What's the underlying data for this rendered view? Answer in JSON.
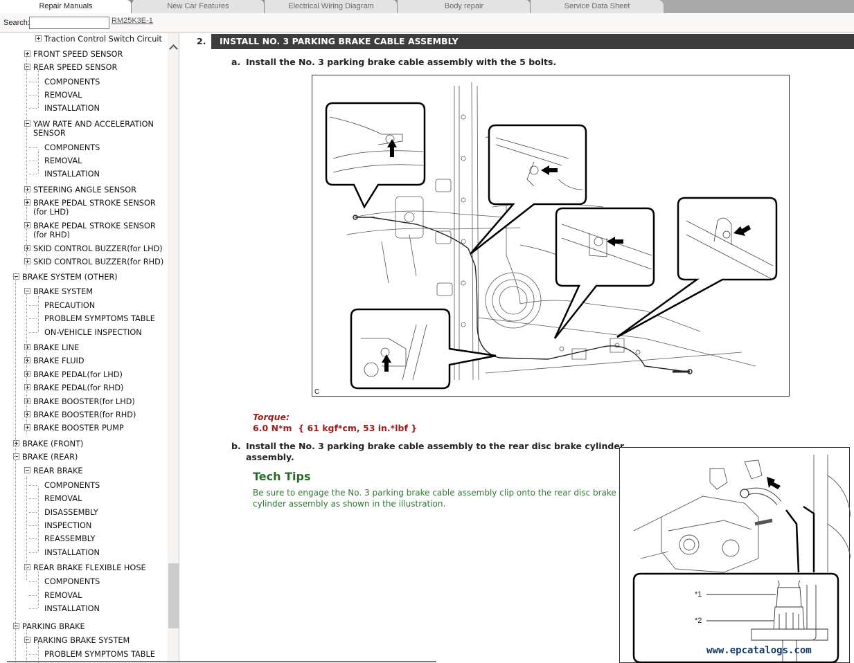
{
  "tabs": [
    {
      "label": "Repair Manuals",
      "active": true
    },
    {
      "label": "New Car Features",
      "active": false
    },
    {
      "label": "Electrical Wiring Diagram",
      "active": false
    },
    {
      "label": "Body repair",
      "active": false
    },
    {
      "label": "Service Data Sheet",
      "active": false
    }
  ],
  "search": {
    "label": "Search:",
    "value": "",
    "placeholder": ""
  },
  "doc_id": "RM25K3E-1",
  "tree": [
    {
      "label": "Traction Control Switch Circuit",
      "level": 3,
      "toggle": "plus"
    },
    {
      "label": "FRONT SPEED SENSOR",
      "level": 2,
      "toggle": "plus"
    },
    {
      "label": "REAR SPEED SENSOR",
      "level": 2,
      "toggle": "minus"
    },
    {
      "label": "COMPONENTS",
      "level": 3,
      "toggle": "none"
    },
    {
      "label": "REMOVAL",
      "level": 3,
      "toggle": "none"
    },
    {
      "label": "INSTALLATION",
      "level": 3,
      "toggle": "none"
    },
    {
      "label": "YAW RATE AND ACCELERATION",
      "label2": "SENSOR",
      "level": 2,
      "toggle": "minus"
    },
    {
      "label": "COMPONENTS",
      "level": 3,
      "toggle": "none"
    },
    {
      "label": "REMOVAL",
      "level": 3,
      "toggle": "none"
    },
    {
      "label": "INSTALLATION",
      "level": 3,
      "toggle": "none"
    },
    {
      "label": "STEERING ANGLE SENSOR",
      "level": 2,
      "toggle": "plus"
    },
    {
      "label": "BRAKE PEDAL STROKE SENSOR",
      "label2": "(for LHD)",
      "level": 2,
      "toggle": "plus"
    },
    {
      "label": "BRAKE PEDAL STROKE SENSOR",
      "label2": "(for RHD)",
      "level": 2,
      "toggle": "plus"
    },
    {
      "label": "SKID CONTROL BUZZER(for LHD)",
      "level": 2,
      "toggle": "plus"
    },
    {
      "label": "SKID CONTROL BUZZER(for RHD)",
      "level": 2,
      "toggle": "plus"
    },
    {
      "label": "BRAKE SYSTEM (OTHER)",
      "level": 1,
      "toggle": "minus"
    },
    {
      "label": "BRAKE SYSTEM",
      "level": 2,
      "toggle": "minus"
    },
    {
      "label": "PRECAUTION",
      "level": 3,
      "toggle": "none"
    },
    {
      "label": "PROBLEM SYMPTOMS TABLE",
      "level": 3,
      "toggle": "none"
    },
    {
      "label": "ON-VEHICLE INSPECTION",
      "level": 3,
      "toggle": "none"
    },
    {
      "label": "BRAKE LINE",
      "level": 2,
      "toggle": "plus"
    },
    {
      "label": "BRAKE FLUID",
      "level": 2,
      "toggle": "plus"
    },
    {
      "label": "BRAKE PEDAL(for LHD)",
      "level": 2,
      "toggle": "plus"
    },
    {
      "label": "BRAKE PEDAL(for RHD)",
      "level": 2,
      "toggle": "plus"
    },
    {
      "label": "BRAKE BOOSTER(for LHD)",
      "level": 2,
      "toggle": "plus"
    },
    {
      "label": "BRAKE BOOSTER(for RHD)",
      "level": 2,
      "toggle": "plus"
    },
    {
      "label": "BRAKE BOOSTER PUMP",
      "level": 2,
      "toggle": "plus"
    },
    {
      "label": "BRAKE (FRONT)",
      "level": 1,
      "toggle": "plus"
    },
    {
      "label": "BRAKE (REAR)",
      "level": 1,
      "toggle": "minus"
    },
    {
      "label": "REAR BRAKE",
      "level": 2,
      "toggle": "minus"
    },
    {
      "label": "COMPONENTS",
      "level": 3,
      "toggle": "none"
    },
    {
      "label": "REMOVAL",
      "level": 3,
      "toggle": "none"
    },
    {
      "label": "DISASSEMBLY",
      "level": 3,
      "toggle": "none"
    },
    {
      "label": "INSPECTION",
      "level": 3,
      "toggle": "none"
    },
    {
      "label": "REASSEMBLY",
      "level": 3,
      "toggle": "none"
    },
    {
      "label": "INSTALLATION",
      "level": 3,
      "toggle": "none"
    },
    {
      "label": "REAR BRAKE FLEXIBLE HOSE",
      "level": 2,
      "toggle": "minus"
    },
    {
      "label": "COMPONENTS",
      "level": 3,
      "toggle": "none"
    },
    {
      "label": "REMOVAL",
      "level": 3,
      "toggle": "none"
    },
    {
      "label": "INSTALLATION",
      "level": 3,
      "toggle": "none"
    },
    {
      "label": "PARKING BRAKE",
      "level": 1,
      "toggle": "minus"
    },
    {
      "label": "PARKING BRAKE SYSTEM",
      "level": 2,
      "toggle": "minus"
    },
    {
      "label": "PROBLEM SYMPTOMS TABLE",
      "level": 3,
      "toggle": "none"
    }
  ],
  "content": {
    "step_number": "2.",
    "step_title": "INSTALL NO. 3 PARKING BRAKE CABLE ASSEMBLY",
    "substep_a": {
      "letter": "a.",
      "text": "Install the No. 3 parking brake cable assembly with the 5 bolts."
    },
    "figure1_label": "C",
    "torque": {
      "label": "Torque:",
      "value": "6.0 N*m  { 61 kgf*cm, 53 in.*lbf }"
    },
    "substep_b": {
      "letter": "b.",
      "text_line1": "Install the No. 3 parking brake cable assembly to the rear disc brake cylinder",
      "text_line2": "assembly."
    },
    "tech_tips": {
      "title": "Tech Tips",
      "text": "Be sure to engage the No. 3 parking brake cable assembly clip onto the rear disc brake cylinder assembly as shown in the illustration."
    },
    "figure2_callouts": [
      "*1",
      "*2"
    ],
    "watermark": "www.epcatalogs.com"
  }
}
